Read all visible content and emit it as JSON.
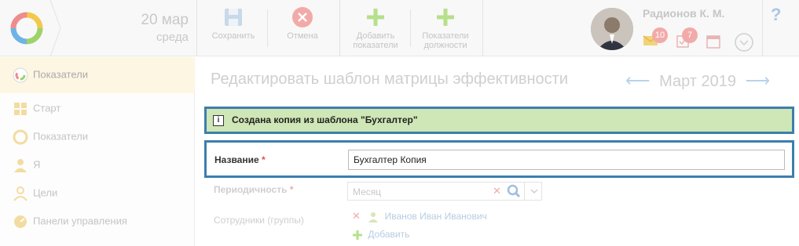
{
  "header": {
    "date_day": "20 мар",
    "date_weekday": "среда",
    "buttons": {
      "save": "Сохранить",
      "cancel": "Отмена",
      "add_indicators": "Добавить показатели",
      "position_indicators": "Показатели должности"
    },
    "user_name": "Радионов К. М.",
    "badge_mail": "10",
    "badge_tasks": "7",
    "help": "?"
  },
  "sidebar": {
    "active": "Показатели",
    "items": [
      "Старт",
      "Показатели",
      "Я",
      "Цели",
      "Панели управления"
    ]
  },
  "main": {
    "title": "Редактировать шаблон матрицы эффективности",
    "month": "Март 2019",
    "notice_icon": "i",
    "notice": "Создана копия из шаблона \"Бухгалтер\"",
    "name_label": "Название",
    "required_mark": "*",
    "name_value": "Бухгалтер Копия",
    "period_label": "Периодичность",
    "period_value": "Месяц",
    "employees_label": "Сотрудники (группы)",
    "employee": "Иванов Иван Иванович",
    "add_label": "Добавить"
  },
  "colors": {
    "accent_blue": "#3c7ead",
    "notice_bg": "#cfe7b6",
    "required": "#d9534f"
  }
}
